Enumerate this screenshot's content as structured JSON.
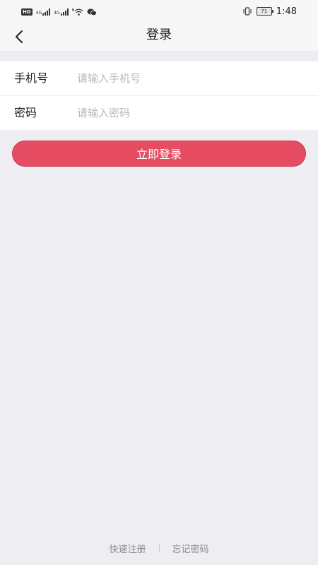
{
  "status_bar": {
    "hd_badge": "HD",
    "network_1": "4G",
    "network_2": "4G",
    "wifi_badge": "6",
    "battery_level": "71",
    "time": "1:48",
    "icons": [
      "sim-hd-icon",
      "signal-icon",
      "signal-icon",
      "wifi-icon",
      "wechat-icon",
      "vibrate-icon",
      "battery-icon"
    ]
  },
  "nav": {
    "title": "登录",
    "back_icon": "chevron-left-icon"
  },
  "form": {
    "phone": {
      "label": "手机号",
      "placeholder": "请输入手机号",
      "value": ""
    },
    "password": {
      "label": "密码",
      "placeholder": "请输入密码",
      "value": ""
    }
  },
  "login_button": {
    "label": "立即登录",
    "color": "#e64d63"
  },
  "footer": {
    "register": "快速注册",
    "forgot": "忘记密码"
  },
  "colors": {
    "background": "#eeedf2",
    "accent": "#e64d63"
  }
}
